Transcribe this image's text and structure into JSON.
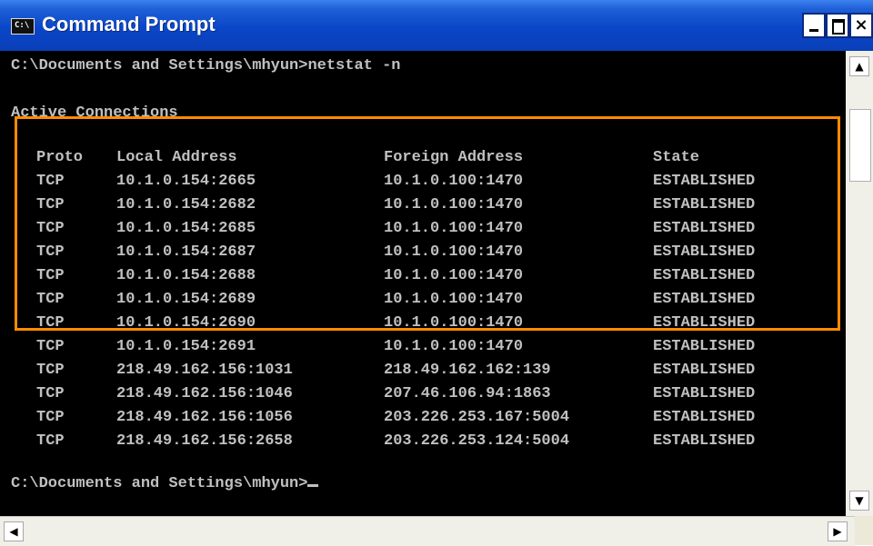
{
  "window": {
    "title": "Command Prompt",
    "icon_label": "C:\\"
  },
  "console": {
    "command_line": "C:\\Documents and Settings\\mhyun>netstat -n",
    "section_title": "Active Connections",
    "headers": {
      "proto": "Proto",
      "local": "Local Address",
      "foreign": "Foreign Address",
      "state": "State"
    },
    "rows": [
      {
        "proto": "TCP",
        "local": "10.1.0.154:2665",
        "foreign": "10.1.0.100:1470",
        "state": "ESTABLISHED"
      },
      {
        "proto": "TCP",
        "local": "10.1.0.154:2682",
        "foreign": "10.1.0.100:1470",
        "state": "ESTABLISHED"
      },
      {
        "proto": "TCP",
        "local": "10.1.0.154:2685",
        "foreign": "10.1.0.100:1470",
        "state": "ESTABLISHED"
      },
      {
        "proto": "TCP",
        "local": "10.1.0.154:2687",
        "foreign": "10.1.0.100:1470",
        "state": "ESTABLISHED"
      },
      {
        "proto": "TCP",
        "local": "10.1.0.154:2688",
        "foreign": "10.1.0.100:1470",
        "state": "ESTABLISHED"
      },
      {
        "proto": "TCP",
        "local": "10.1.0.154:2689",
        "foreign": "10.1.0.100:1470",
        "state": "ESTABLISHED"
      },
      {
        "proto": "TCP",
        "local": "10.1.0.154:2690",
        "foreign": "10.1.0.100:1470",
        "state": "ESTABLISHED"
      },
      {
        "proto": "TCP",
        "local": "10.1.0.154:2691",
        "foreign": "10.1.0.100:1470",
        "state": "ESTABLISHED"
      },
      {
        "proto": "TCP",
        "local": "218.49.162.156:1031",
        "foreign": "218.49.162.162:139",
        "state": "ESTABLISHED"
      },
      {
        "proto": "TCP",
        "local": "218.49.162.156:1046",
        "foreign": "207.46.106.94:1863",
        "state": "ESTABLISHED"
      },
      {
        "proto": "TCP",
        "local": "218.49.162.156:1056",
        "foreign": "203.226.253.167:5004",
        "state": "ESTABLISHED"
      },
      {
        "proto": "TCP",
        "local": "218.49.162.156:2658",
        "foreign": "203.226.253.124:5004",
        "state": "ESTABLISHED"
      }
    ],
    "prompt": "C:\\Documents and Settings\\mhyun>"
  },
  "colors": {
    "titlebar": "#0a46c8",
    "console_bg": "#000000",
    "console_text": "#c0c0c0",
    "highlight_border": "#ff8c00"
  },
  "icons": {
    "minimize": "minimize-icon",
    "maximize": "maximize-icon",
    "close": "close-icon",
    "scroll_up": "arrow-up-icon",
    "scroll_down": "arrow-down-icon",
    "scroll_left": "arrow-left-icon",
    "scroll_right": "arrow-right-icon"
  }
}
